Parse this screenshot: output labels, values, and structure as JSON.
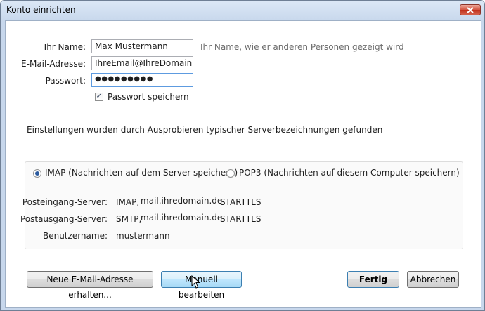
{
  "window": {
    "title": "Konto einrichten"
  },
  "form": {
    "name_label": "Ihr Name:",
    "name_value": "Max Mustermann",
    "name_hint": "Ihr Name, wie er anderen Personen gezeigt wird",
    "email_label": "E-Mail-Adresse:",
    "email_value": "IhreEmail@IhreDomain.de",
    "password_label": "Passwort:",
    "password_value": "●●●●●●●●●",
    "save_password_label": "Passwort speichern",
    "save_password_checked": true
  },
  "status": {
    "message": "Einstellungen wurden durch Ausprobieren typischer Serverbezeichnungen gefunden"
  },
  "protocol": {
    "imap_label": "IMAP (Nachrichten auf dem Server speichern)",
    "pop3_label": "POP3 (Nachrichten auf diesem Computer speichern)",
    "selected": "IMAP"
  },
  "servers": {
    "incoming_label": "Posteingang-Server:",
    "incoming_proto": "IMAP,",
    "incoming_host": "mail.ihredomain.de",
    "incoming_security": "STARTTLS",
    "outgoing_label": "Postausgang-Server:",
    "outgoing_proto": "SMTP,",
    "outgoing_host": "mail.ihredomain.de",
    "outgoing_security": "STARTTLS",
    "username_label": "Benutzername:",
    "username_value": "mustermann"
  },
  "buttons": {
    "new_address": "Neue E-Mail-Adresse erhalten...",
    "manual_edit": "Manuell bearbeiten",
    "done": "Fertig",
    "cancel": "Abbrechen"
  },
  "colors": {
    "title_bar": "#c7d7ec",
    "close_button": "#c0301c",
    "focus_border": "#5d9be0",
    "button_hover": "#bee6fd"
  }
}
